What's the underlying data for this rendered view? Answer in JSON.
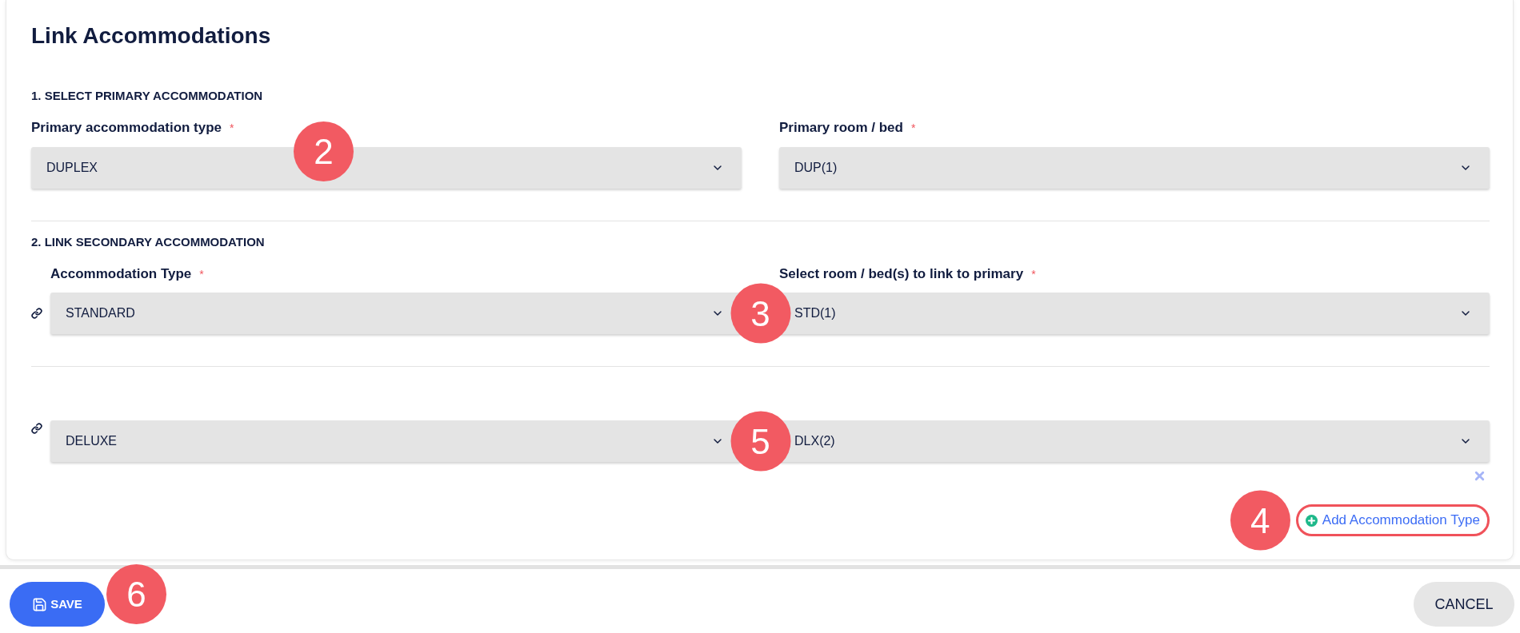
{
  "title": "Link Accommodations",
  "primary": {
    "heading": "1. SELECT PRIMARY ACCOMMODATION",
    "fields": [
      {
        "label": "Primary accommodation type",
        "required_mark": "*",
        "value": "DUPLEX",
        "callout": "2"
      },
      {
        "label": "Primary room / bed",
        "required_mark": "*",
        "value": "DUP(1)"
      }
    ]
  },
  "secondary": {
    "heading": "2. LINK SECONDARY ACCOMMODATION",
    "rows": [
      {
        "type": {
          "label": "Accommodation Type",
          "required_mark": "*",
          "value": "STANDARD"
        },
        "rooms": {
          "label": "Select room / bed(s) to link to primary",
          "required_mark": "*",
          "value": "STD(1)"
        },
        "callout": "3",
        "removable": false
      },
      {
        "type": {
          "value": "DELUXE"
        },
        "rooms": {
          "value": "DLX(2)"
        },
        "callout": "5",
        "removable": true
      }
    ]
  },
  "add_link": {
    "label": "Add Accommodation Type",
    "highlighted": true,
    "callout": "4"
  },
  "footer": {
    "buttons": [
      {
        "kind": "primary",
        "label": "SAVE",
        "callout": "6"
      },
      {
        "kind": "secondary",
        "label": "CANCEL"
      }
    ]
  }
}
